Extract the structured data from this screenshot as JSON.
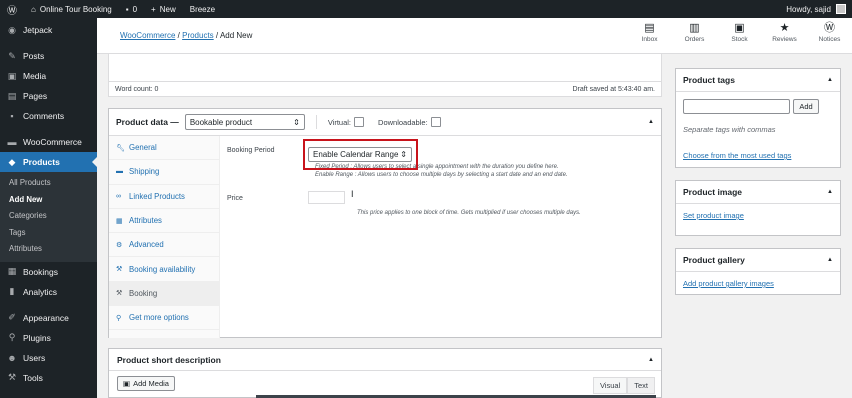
{
  "adminbar": {
    "site_name": "Online Tour Booking",
    "comments_count": "0",
    "new_label": "New",
    "breeze_label": "Breeze",
    "howdy": "Howdy, sajid"
  },
  "sidebar": {
    "items": [
      {
        "label": "Jetpack",
        "icon": "jetpack-icon"
      },
      {
        "label": "Posts",
        "icon": "pin-icon"
      },
      {
        "label": "Media",
        "icon": "media-icon"
      },
      {
        "label": "Pages",
        "icon": "pages-icon"
      },
      {
        "label": "Comments",
        "icon": "comment-icon"
      },
      {
        "label": "WooCommerce",
        "icon": "woocommerce-icon"
      },
      {
        "label": "Products",
        "icon": "products-icon"
      },
      {
        "label": "Bookings",
        "icon": "calendar-icon"
      },
      {
        "label": "Analytics",
        "icon": "chart-icon"
      },
      {
        "label": "Appearance",
        "icon": "brush-icon"
      },
      {
        "label": "Plugins",
        "icon": "plug-icon"
      },
      {
        "label": "Users",
        "icon": "users-icon"
      },
      {
        "label": "Tools",
        "icon": "wrench-icon"
      }
    ],
    "submenu": [
      "All Products",
      "Add New",
      "Categories",
      "Tags",
      "Attributes"
    ]
  },
  "header": {
    "crumb_1": "WooCommerce",
    "crumb_2": "Products",
    "crumb_current": "Add New",
    "icons": [
      {
        "label": "Inbox",
        "icon": "inbox-icon"
      },
      {
        "label": "Orders",
        "icon": "orders-icon"
      },
      {
        "label": "Stock",
        "icon": "stock-icon"
      },
      {
        "label": "Reviews",
        "icon": "star-icon"
      },
      {
        "label": "Notices",
        "icon": "wordpress-icon"
      }
    ]
  },
  "editor": {
    "word_count": "Word count: 0",
    "draft_saved": "Draft saved at 5:43:40 am."
  },
  "product_data": {
    "title": "Product data —",
    "type_selected": "Bookable product",
    "virtual_label": "Virtual:",
    "downloadable_label": "Downloadable:",
    "tabs": [
      {
        "label": "General",
        "icon": "wrench-icon"
      },
      {
        "label": "Shipping",
        "icon": "truck-icon"
      },
      {
        "label": "Linked Products",
        "icon": "link-icon"
      },
      {
        "label": "Attributes",
        "icon": "list-icon"
      },
      {
        "label": "Advanced",
        "icon": "gear-icon"
      },
      {
        "label": "Booking availability",
        "icon": "wrench-icon"
      },
      {
        "label": "Booking",
        "icon": "wrench-icon"
      },
      {
        "label": "Get more options",
        "icon": "plugin-icon"
      }
    ],
    "booking_period_label": "Booking Period",
    "booking_period_value": "Enable Calendar Range",
    "booking_desc_1": "Fixed Period : Allows users to select a single appointment with the duration you define here.",
    "booking_desc_2": "Enable Range : Allows users to choose multiple days by selecting a start date and an end date.",
    "price_label": "Price",
    "price_desc": "This price applies to one block of time. Gets multiplied if user chooses multiple days."
  },
  "short_description": {
    "title": "Product short description",
    "add_media": "Add Media",
    "visual_tab": "Visual",
    "text_tab": "Text"
  },
  "right_boxes": {
    "tags_title": "Product tags",
    "tags_add": "Add",
    "tags_hint": "Separate tags with commas",
    "tags_link": "Choose from the most used tags",
    "image_title": "Product image",
    "image_link": "Set product image",
    "gallery_title": "Product gallery",
    "gallery_link": "Add product gallery images"
  },
  "colors": {
    "admin_dark": "#1d2327",
    "accent_blue": "#2271b1",
    "highlight_red": "#c8131b"
  }
}
